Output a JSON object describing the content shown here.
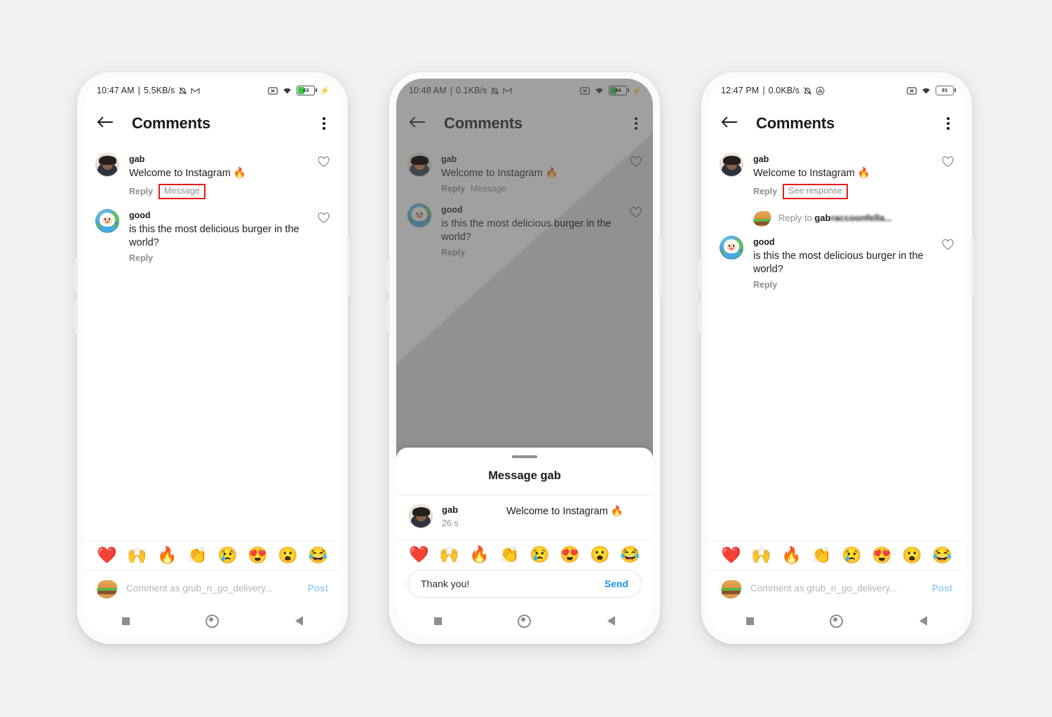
{
  "background_color": "#f2f2f2",
  "highlight_color": "#e8191b",
  "accent_blue": "#1b8ff0",
  "phones": [
    {
      "id": "phone-1",
      "status": {
        "time": "10:47 AM",
        "separator": "|",
        "netspeed": "5.5KB/s",
        "icons": [
          "alarm-off-icon",
          "gmail-icon"
        ],
        "right_icons": [
          "no-sim-icon",
          "wifi-icon"
        ],
        "battery_level": "43",
        "charging": true
      },
      "header": {
        "back": "back-arrow-icon",
        "title": "Comments",
        "menu": "kebab-menu-icon"
      },
      "comments": [
        {
          "avatar": "gab-avatar",
          "user": "gab",
          "text": "Welcome to Instagram 🔥",
          "actions": [
            "Reply",
            "Message"
          ],
          "highlighted_action": "Message",
          "liked": false
        },
        {
          "avatar": "finn-avatar",
          "user": "good",
          "text": "is this the most delicious burger in the world?",
          "actions": [
            "Reply"
          ],
          "highlighted_action": null,
          "liked": false
        }
      ],
      "emoji_bar": [
        "❤️",
        "🙌",
        "🔥",
        "👏",
        "😢",
        "😍",
        "😮",
        "😂"
      ],
      "composer": {
        "avatar": "burger-avatar",
        "placeholder": "Comment as grub_n_go_delivery...",
        "post_label": "Post"
      },
      "navbar": [
        "recents-square-icon",
        "home-circle-icon",
        "back-triangle-icon"
      ],
      "sheet": null,
      "dimmed": false
    },
    {
      "id": "phone-2",
      "status": {
        "time": "10:48 AM",
        "separator": "|",
        "netspeed": "0.1KB/s",
        "icons": [
          "alarm-off-icon",
          "gmail-icon"
        ],
        "right_icons": [
          "no-sim-icon",
          "wifi-icon"
        ],
        "battery_level": "44",
        "charging": true
      },
      "header": {
        "back": "back-arrow-icon",
        "title": "Comments",
        "menu": "kebab-menu-icon"
      },
      "comments": [
        {
          "avatar": "gab-avatar",
          "user": "gab",
          "text": "Welcome to Instagram 🔥",
          "actions": [
            "Reply",
            "Message"
          ],
          "highlighted_action": null,
          "liked": false
        },
        {
          "avatar": "finn-avatar",
          "user": "good",
          "text": "is this the most delicious burger in the world?",
          "actions": [
            "Reply"
          ],
          "highlighted_action": null,
          "liked": false
        }
      ],
      "emoji_bar": [
        "❤️",
        "🙌",
        "🔥",
        "👏",
        "😢",
        "😍",
        "😮",
        "😂"
      ],
      "composer": null,
      "navbar": [
        "recents-square-icon",
        "home-circle-icon",
        "back-triangle-icon"
      ],
      "dimmed": true,
      "sheet": {
        "title": "Message gab",
        "message": {
          "avatar": "gab-avatar",
          "user": "gab",
          "time": "26 s",
          "text": "Welcome to Instagram 🔥"
        },
        "input_value": "Thank you!",
        "send_label": "Send"
      }
    },
    {
      "id": "phone-3",
      "status": {
        "time": "12:47 PM",
        "separator": "|",
        "netspeed": "0.0KB/s",
        "icons": [
          "alarm-off-icon",
          "cloud-icon"
        ],
        "right_icons": [
          "no-sim-icon",
          "wifi-icon"
        ],
        "battery_level": "91",
        "charging": false
      },
      "header": {
        "back": "back-arrow-icon",
        "title": "Comments",
        "menu": "kebab-menu-icon"
      },
      "comments": [
        {
          "avatar": "gab-avatar",
          "user": "gab",
          "text": "Welcome to Instagram 🔥",
          "actions": [
            "Reply",
            "See response"
          ],
          "highlighted_action": "See response",
          "liked": false
        },
        {
          "avatar": "finn-avatar",
          "user": "good",
          "text": "is this the most delicious burger in the world?",
          "actions": [
            "Reply"
          ],
          "highlighted_action": null,
          "liked": false
        }
      ],
      "inline_reply": {
        "avatar": "burger-avatar",
        "prefix": "Reply to ",
        "name": "gab",
        "blurred_suffix": "raccoonfella..."
      },
      "emoji_bar": [
        "❤️",
        "🙌",
        "🔥",
        "👏",
        "😢",
        "😍",
        "😮",
        "😂"
      ],
      "composer": {
        "avatar": "burger-avatar",
        "placeholder": "Comment as grub_n_go_delivery...",
        "post_label": "Post"
      },
      "navbar": [
        "recents-square-icon",
        "home-circle-icon",
        "back-triangle-icon"
      ],
      "dimmed": false,
      "sheet": null
    }
  ]
}
